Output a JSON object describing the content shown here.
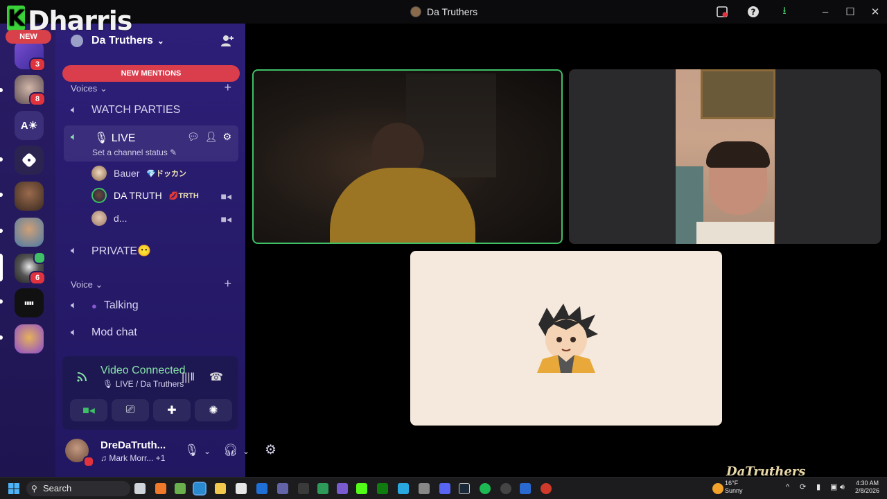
{
  "window": {
    "title": "Da Truthers"
  },
  "overlay": {
    "watermark": "Dharris",
    "new_label": "NEW",
    "bottom_watermark": "DaTruthers"
  },
  "server_rail": {
    "badges": [
      "3",
      "8",
      "6"
    ],
    "text_icon": "A☀"
  },
  "sidebar": {
    "server_name": "Da Truthers",
    "new_mentions": "NEW MENTIONS",
    "category_voices": "Voices",
    "category_voice": "Voice",
    "channels": {
      "watch_parties": "WATCH PARTIES",
      "live": "LIVE",
      "live_status": "Set a channel status",
      "private": "PRIVATE😶",
      "talking": "Talking",
      "mod_chat": "Mod chat"
    },
    "voice_users": [
      {
        "name": "Bauer",
        "tag": "💎ドッカン"
      },
      {
        "name": "DA TRUTH",
        "tag": "💋TRTH"
      },
      {
        "name": "d...",
        "tag": ""
      }
    ]
  },
  "voice_panel": {
    "status": "Video Connected",
    "location": "LIVE / Da Truthers"
  },
  "user_bar": {
    "username": "DreDaTruth...",
    "activity": "Mark Morr... +1"
  },
  "taskbar": {
    "search": "Search",
    "weather_temp": "16°F",
    "weather_desc": "Sunny",
    "time": "4:30 AM",
    "date": "2/8/2026"
  },
  "colors": {
    "speaking_border": "#3fc066",
    "mention_red": "#da3d4c",
    "sidebar_bg": "#2d1f78"
  }
}
